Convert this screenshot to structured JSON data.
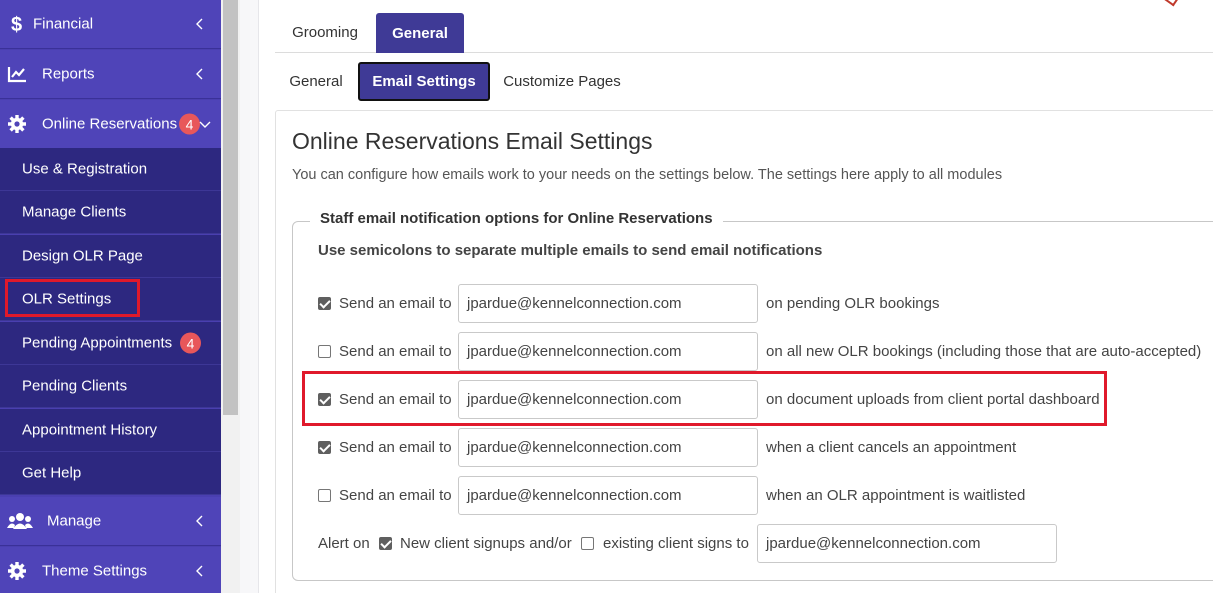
{
  "sidebar": {
    "main_items": [
      {
        "label": "Financial",
        "icon": "dollar-icon"
      },
      {
        "label": "Reports",
        "icon": "chart-line-icon"
      },
      {
        "label": "Online Reservations",
        "icon": "gear-icon",
        "badge": "4"
      },
      {
        "label": "Manage",
        "icon": "users-icon"
      },
      {
        "label": "Theme Settings",
        "icon": "gear-icon"
      }
    ],
    "sub_items": [
      {
        "label": "Use & Registration"
      },
      {
        "label": "Manage Clients"
      },
      {
        "label": "Design OLR Page"
      },
      {
        "label": "OLR Settings"
      },
      {
        "label": "Pending Appointments",
        "badge": "4"
      },
      {
        "label": "Pending Clients"
      },
      {
        "label": "Appointment History"
      },
      {
        "label": "Get Help"
      }
    ]
  },
  "tabs_top": [
    "Grooming",
    "General"
  ],
  "tabs_sub": [
    "General",
    "Email Settings",
    "Customize Pages"
  ],
  "page": {
    "title": "Online Reservations Email Settings",
    "description": "You can configure how emails work to your needs on the settings below. The settings here apply to all modules",
    "fieldset_legend": "Staff email notification options for Online Reservations",
    "instruction": "Use semicolons to separate multiple emails to send email notifications"
  },
  "email_rows": [
    {
      "checked": true,
      "label": "Send an email to",
      "email": "jpardue@kennelconnection.com",
      "suffix": "on pending OLR bookings"
    },
    {
      "checked": false,
      "label": "Send an email to",
      "email": "jpardue@kennelconnection.com",
      "suffix": "on all new OLR bookings (including those that are auto-accepted)"
    },
    {
      "checked": true,
      "label": "Send an email to",
      "email": "jpardue@kennelconnection.com",
      "suffix": "on document uploads from client portal dashboard"
    },
    {
      "checked": true,
      "label": "Send an email to",
      "email": "jpardue@kennelconnection.com",
      "suffix": "when a client cancels an appointment"
    },
    {
      "checked": false,
      "label": "Send an email to",
      "email": "jpardue@kennelconnection.com",
      "suffix": "when an OLR appointment is waitlisted"
    }
  ],
  "alert_row": {
    "prefix": "Alert on",
    "new_checked": true,
    "new_label": "New client signups and/or",
    "existing_checked": false,
    "existing_label": "existing client signs to",
    "email": "jpardue@kennelconnection.com"
  },
  "colors": {
    "sidebar_bg": "#4f44b8",
    "sidebar_sub_bg": "#2d2880",
    "accent": "#3f3a96",
    "badge": "#e8575a",
    "highlight": "#e0192b"
  }
}
